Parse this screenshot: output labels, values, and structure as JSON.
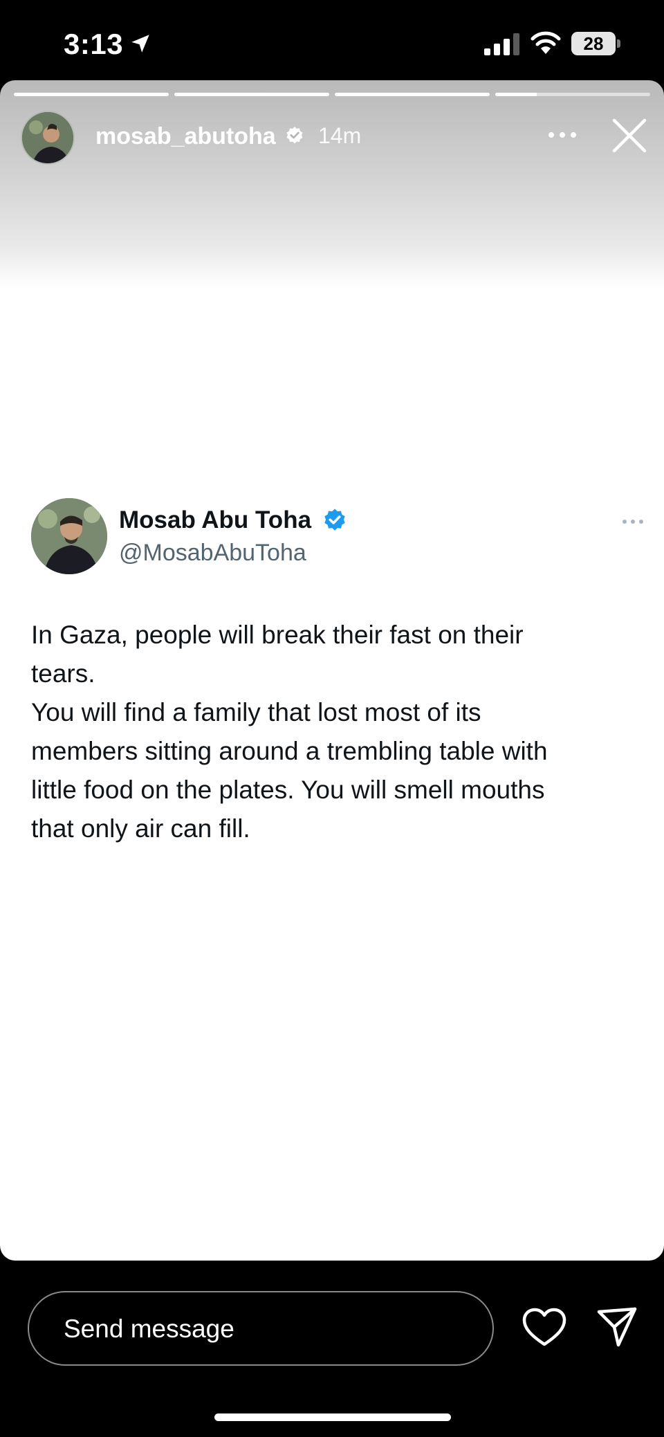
{
  "status_bar": {
    "time": "3:13",
    "battery_level": "28"
  },
  "story": {
    "username": "mosab_abutoha",
    "time_ago": "14m",
    "segments": [
      {
        "progress": 1.0
      },
      {
        "progress": 1.0
      },
      {
        "progress": 1.0
      },
      {
        "progress": 0.27
      }
    ]
  },
  "tweet": {
    "name": "Mosab Abu Toha",
    "handle": "@MosabAbuToha",
    "text": "In Gaza, people will break their fast on their\ntears.\nYou will find a family that lost most of its\nmembers sitting around a trembling table with\nlittle food on the plates. You will smell mouths\nthat only air can fill."
  },
  "bottom_bar": {
    "placeholder": "Send message"
  },
  "colors": {
    "verified_blue": "#1d9bf0",
    "name_text": "#0f1419",
    "handle_text": "#536471"
  }
}
